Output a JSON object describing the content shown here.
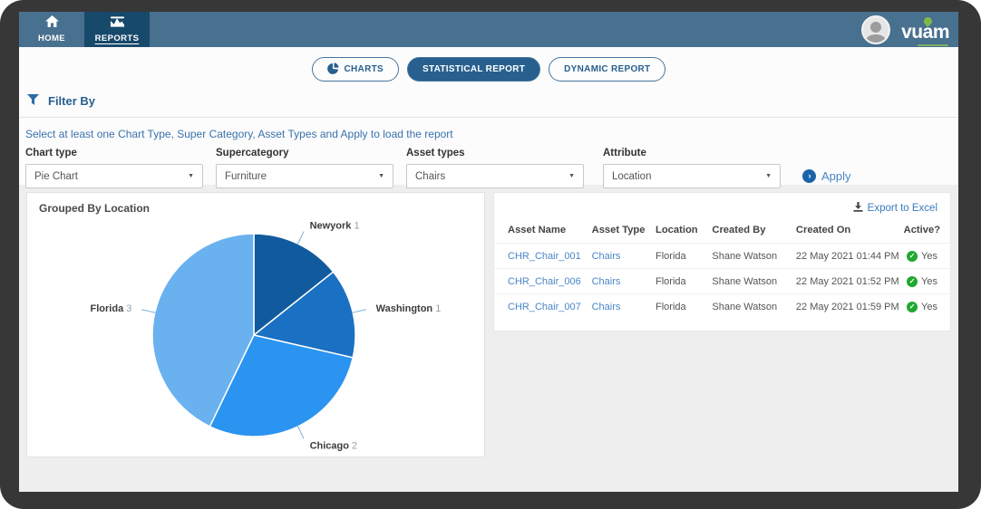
{
  "nav": {
    "home_label": "HOME",
    "reports_label": "REPORTS",
    "brand_part1": "vu",
    "brand_part2": "am"
  },
  "view_tabs": {
    "charts_label": "CHARTS",
    "statistical_label": "STATISTICAL REPORT",
    "dynamic_label": "DYNAMIC REPORT"
  },
  "filter": {
    "title": "Filter By",
    "instruction": "Select at least one Chart Type, Super Category, Asset Types and Apply to load the report",
    "chart_type_label": "Chart type",
    "chart_type_value": "Pie Chart",
    "supercategory_label": "Supercategory",
    "supercategory_value": "Furniture",
    "asset_types_label": "Asset types",
    "asset_types_value": "Chairs",
    "attribute_label": "Attribute",
    "attribute_value": "Location",
    "apply_label": "Apply"
  },
  "chart_data": {
    "type": "pie",
    "title": "Grouped By Location",
    "categories": [
      "Newyork",
      "Washington",
      "Chicago",
      "Florida"
    ],
    "values": [
      1,
      1,
      2,
      3
    ],
    "slice_colors": [
      "#125a9e",
      "#1a70c2",
      "#2b93f0",
      "#6ab1ef"
    ],
    "start_angle_deg": 0,
    "direction": "clockwise",
    "legend_position": "none",
    "labels_show_values": true
  },
  "table": {
    "export_label": "Export to Excel",
    "columns": [
      "Asset Name",
      "Asset Type",
      "Location",
      "Created By",
      "Created On",
      "Active?"
    ],
    "rows": [
      {
        "asset_name": "CHR_Chair_001",
        "asset_type": "Chairs",
        "location": "Florida",
        "created_by": "Shane Watson",
        "created_on": "22 May 2021 01:44 PM",
        "active": "Yes"
      },
      {
        "asset_name": "CHR_Chair_006",
        "asset_type": "Chairs",
        "location": "Florida",
        "created_by": "Shane Watson",
        "created_on": "22 May 2021 01:52 PM",
        "active": "Yes"
      },
      {
        "asset_name": "CHR_Chair_007",
        "asset_type": "Chairs",
        "location": "Florida",
        "created_by": "Shane Watson",
        "created_on": "22 May 2021 01:59 PM",
        "active": "Yes"
      }
    ]
  },
  "colors": {
    "navbar": "#48708f",
    "active_nav_tab": "#17496b",
    "accent_blue": "#27608f",
    "link_blue": "#4a86c5",
    "success_green": "#1fa830",
    "brand_green": "#7fb94a",
    "frame": "#373737",
    "page_bg": "#eeeeee"
  }
}
